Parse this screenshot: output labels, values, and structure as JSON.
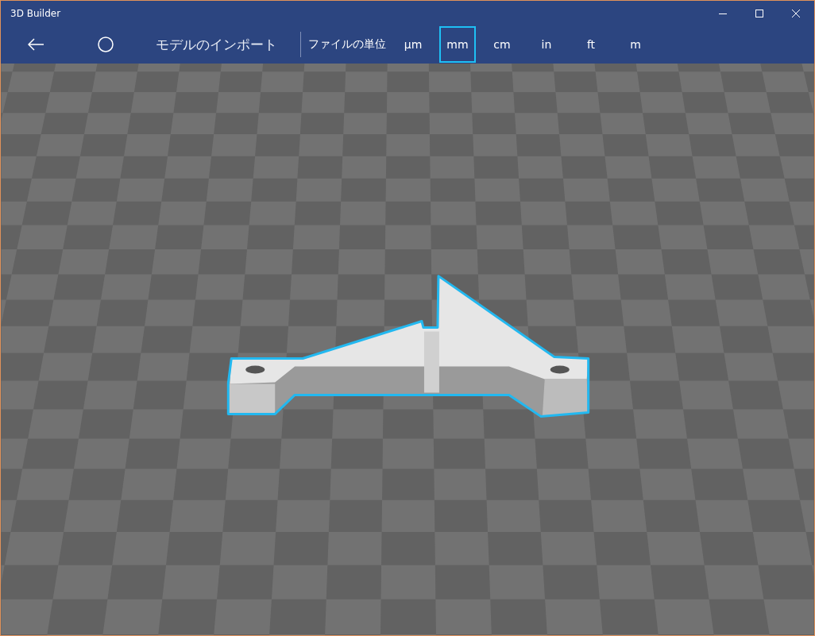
{
  "window": {
    "title": "3D Builder"
  },
  "toolbar": {
    "heading": "モデルのインポート",
    "units_label": "ファイルの単位",
    "units": [
      {
        "label": "µm",
        "selected": false
      },
      {
        "label": "mm",
        "selected": true
      },
      {
        "label": "cm",
        "selected": false
      },
      {
        "label": "in",
        "selected": false
      },
      {
        "label": "ft",
        "selected": false
      },
      {
        "label": "m",
        "selected": false
      }
    ]
  }
}
